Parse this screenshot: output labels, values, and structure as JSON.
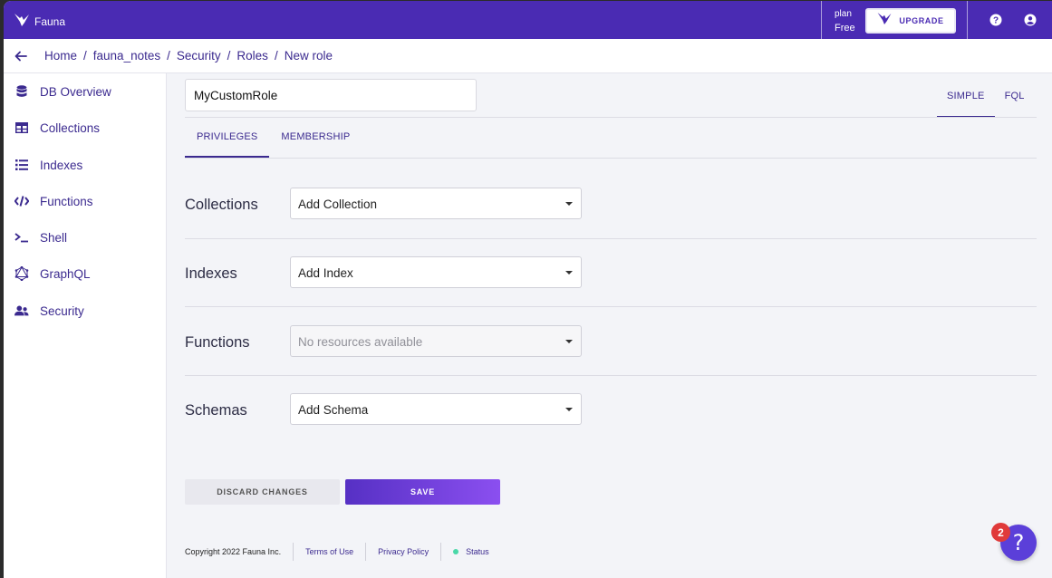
{
  "brand": {
    "name": "Fauna"
  },
  "plan": {
    "label": "plan",
    "value": "Free",
    "upgrade_label": "UPGRADE"
  },
  "breadcrumb": [
    "Home",
    "fauna_notes",
    "Security",
    "Roles",
    "New role"
  ],
  "sidebar": {
    "items": [
      {
        "label": "DB Overview",
        "icon": "database-icon"
      },
      {
        "label": "Collections",
        "icon": "table-icon"
      },
      {
        "label": "Indexes",
        "icon": "list-icon"
      },
      {
        "label": "Functions",
        "icon": "code-icon"
      },
      {
        "label": "Shell",
        "icon": "terminal-icon"
      },
      {
        "label": "GraphQL",
        "icon": "graphql-icon"
      },
      {
        "label": "Security",
        "icon": "users-icon"
      }
    ]
  },
  "role": {
    "name": "MyCustomRole"
  },
  "mode_tabs": {
    "simple": "SIMPLE",
    "fql": "FQL",
    "active": "SIMPLE"
  },
  "sub_tabs": {
    "privileges": "PRIVILEGES",
    "membership": "MEMBERSHIP",
    "active": "PRIVILEGES"
  },
  "privileges": {
    "rows": [
      {
        "label": "Collections",
        "select": "Add Collection",
        "disabled": false
      },
      {
        "label": "Indexes",
        "select": "Add Index",
        "disabled": false
      },
      {
        "label": "Functions",
        "select": "No resources available",
        "disabled": true
      },
      {
        "label": "Schemas",
        "select": "Add Schema",
        "disabled": false
      }
    ]
  },
  "actions": {
    "discard": "DISCARD CHANGES",
    "save": "SAVE"
  },
  "footer": {
    "copyright": "Copyright 2022 Fauna Inc.",
    "terms": "Terms of Use",
    "privacy": "Privacy Policy",
    "status": "Status"
  },
  "help_fab": {
    "badge": "2",
    "icon": "?"
  },
  "colors": {
    "primary": "#4a2bb3",
    "accent": "#3b2a8f",
    "status_ok": "#4ad8a8",
    "badge": "#e03a3a"
  }
}
